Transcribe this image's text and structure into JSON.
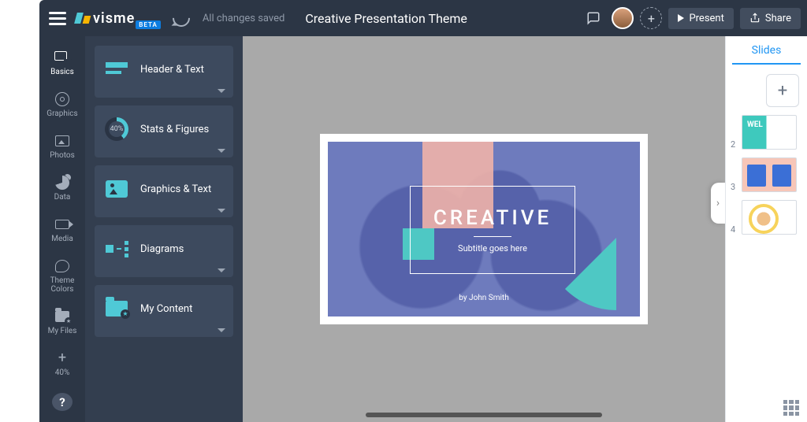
{
  "topbar": {
    "logo_text": "visme",
    "beta": "BETA",
    "save_status": "All changes saved",
    "title": "Creative Presentation Theme",
    "present_label": "Present",
    "share_label": "Share"
  },
  "rail": {
    "items": [
      {
        "label": "Basics"
      },
      {
        "label": "Graphics"
      },
      {
        "label": "Photos"
      },
      {
        "label": "Data"
      },
      {
        "label": "Media"
      },
      {
        "label": "Theme Colors"
      },
      {
        "label": "My Files"
      }
    ],
    "zoom": "40%",
    "help": "?"
  },
  "panel": {
    "items": [
      {
        "label": "Header & Text"
      },
      {
        "label": "Stats & Figures",
        "badge": "40%"
      },
      {
        "label": "Graphics & Text"
      },
      {
        "label": "Diagrams"
      },
      {
        "label": "My Content"
      }
    ]
  },
  "canvas": {
    "title": "CREATIVE",
    "subtitle": "Subtitle goes here",
    "byline": "by John Smith"
  },
  "slides": {
    "tab": "Slides",
    "add": "+",
    "thumbs": [
      {
        "num": "2"
      },
      {
        "num": "3"
      },
      {
        "num": "4"
      }
    ]
  }
}
